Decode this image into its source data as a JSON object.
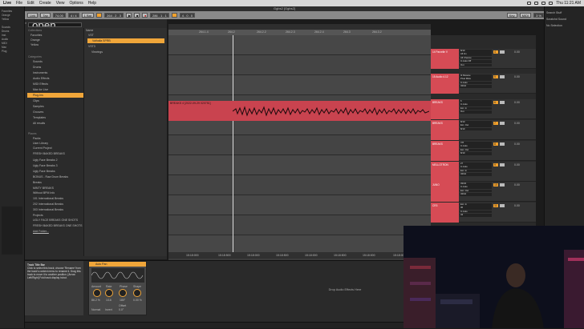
{
  "menubar": {
    "app": "Live",
    "items": [
      "File",
      "Edit",
      "Create",
      "View",
      "Options",
      "Help"
    ],
    "time": "Thu 11:21 AM"
  },
  "window": {
    "title": "Ggbs2 [Ggbs2]"
  },
  "transport": {
    "link": "Link",
    "tap": "Tap",
    "tempo": "74.00",
    "signature": "4 / 4",
    "quant": "1 Bar",
    "position": "264 . 2 . 3",
    "end": "286 . 1 . 1",
    "loop": "4 . 0 . 0",
    "key": "Key",
    "midi": "MIDI",
    "cpu": "3 %"
  },
  "browser": {
    "search_value": "open",
    "collections_header": "Collections",
    "collections": [
      "Favorites",
      "Orange",
      "Yellow"
    ],
    "categories_header": "Categories",
    "categories": [
      "Sounds",
      "Drums",
      "Instruments",
      "Audio Effects",
      "MIDI Effects",
      "Max for Live",
      "Plug-Ins",
      "Clips",
      "Samples",
      "Grooves",
      "Templates",
      "All results"
    ],
    "places_header": "Places",
    "places": [
      "Packs",
      "User Library",
      "Current Project",
      "FRESH BAKED BREAKS",
      "Ugly Face Breaks 2",
      "Ugly Face Breaks 3",
      "Ugly Face Breaks",
      "BONUS - Raw Drum Breaks",
      "Breaks",
      "MINTY BREAKS",
      "Without BPM Info",
      "101 International Breaks",
      "202 International Breaks",
      "303 International Breaks",
      "Projects",
      "UGLY FACE BREAKS ONE SHOTS",
      "FRESH BAKED BREAKS ONE SHOTS",
      "Add Folder..."
    ],
    "name_header": "Name",
    "contents": [
      "VST",
      "Valhalla SPRB",
      "VST3",
      "Vlewings"
    ]
  },
  "arrangement": {
    "ruler": [
      "264.1.4",
      "264.2",
      "264.2.2",
      "264.2.3",
      "264.2.4",
      "264.3",
      "264.3.2"
    ],
    "clip_title": "BREAKS 4 [2022-09-29 020751]",
    "timeline": [
      "15:18:000",
      "15:18:500",
      "15:18:000",
      "15:18:500",
      "15:18:000",
      "15:18:500",
      "15:18:000",
      "15:18:000"
    ]
  },
  "tracks": [
    {
      "name": "14 Parcelle V",
      "io": [
        "8/10",
        "All Ins",
        "All Channe",
        "In Auto Off",
        "Out",
        "10/10"
      ],
      "num": "4",
      "vol": "0.00"
    },
    {
      "name": "15 Audio 4.12",
      "io": [
        "Iil Parame",
        "Pixel Mitre",
        "In Auto",
        "43/44"
      ],
      "num": "5",
      "vol": "0.00"
    },
    {
      "name": "BREAKS",
      "io": [
        "6",
        "In Auto",
        "Ext. In",
        "Out"
      ],
      "num": "6",
      "vol": "0.00"
    },
    {
      "name": "BREAKS",
      "io": [
        "8/10",
        "Ext. Out",
        "8/10"
      ],
      "num": "7",
      "vol": "0.00"
    },
    {
      "name": "BREAKS",
      "io": [
        "7/8",
        "In Auto",
        "Ext. Out",
        "8/10"
      ],
      "num": "8",
      "vol": "0.00"
    },
    {
      "name": "MELLOTRON",
      "io": [
        "27",
        "In Auto",
        "Ext. In",
        "43/44"
      ],
      "num": "9",
      "vol": "0.00"
    },
    {
      "name": "JUNO",
      "io": [
        "33/34",
        "In Auto",
        "Ext. Out",
        "43/44"
      ],
      "num": "10",
      "vol": "0.00"
    },
    {
      "name": "CR3",
      "io": [
        "Ext. In",
        "36",
        "In Auto",
        "43"
      ],
      "num": "11",
      "vol": "0.00"
    }
  ],
  "info": {
    "title": "Track Title Bar",
    "text": "Click to select this track; choose 'Rename' from the track's context menu to rename it. Drag this track to move it to another position. [Arrow Left/Right] Fold track display in/out."
  },
  "device": {
    "name": "Auto Pan",
    "params": [
      {
        "label": "Amount",
        "value": "86.2 %"
      },
      {
        "label": "Rate",
        "value": "1/16"
      },
      {
        "label": "Phase",
        "value": "180°"
      },
      {
        "label": "Shape",
        "value": "0.00 %"
      }
    ],
    "modes": [
      "Normal",
      "Invert"
    ],
    "offset_label": "Offset",
    "offset_value": "0.0°"
  },
  "dropzone": "Drop Audio Effects Here",
  "outerleft": [
    "Favorites",
    "Orange",
    "Yellow",
    "Sounds",
    "Drums",
    "Inst.",
    "Audio",
    "MIDI",
    "Max",
    "Plug"
  ],
  "outerright": {
    "title": "Search Stuff",
    "items": [
      "Scratchd Sound",
      "No Selection"
    ]
  }
}
